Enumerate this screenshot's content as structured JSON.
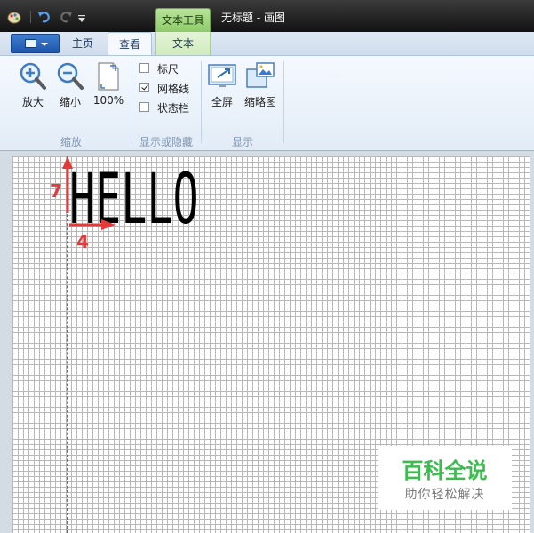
{
  "window": {
    "context_tab_header": "文本工具",
    "title": "无标题 - 画图"
  },
  "tabs": {
    "home": "主页",
    "view": "查看",
    "text": "文本"
  },
  "ribbon": {
    "zoom_group": {
      "label": "缩放",
      "zoom_in": "放大",
      "zoom_out": "缩小",
      "zoom_100": "100%"
    },
    "show_hide_group": {
      "label": "显示或隐藏",
      "items": [
        {
          "label": "标尺",
          "checked": false
        },
        {
          "label": "网格线",
          "checked": true
        },
        {
          "label": "状态栏",
          "checked": false
        }
      ]
    },
    "display_group": {
      "label": "显示",
      "fullscreen": "全屏",
      "thumbnail": "缩略图"
    }
  },
  "canvas": {
    "text": "HELLO",
    "annotations": {
      "vertical_number": "7",
      "horizontal_number": "4",
      "color": "#e53a3a"
    }
  },
  "watermark": {
    "title": "百科全说",
    "subtitle": "助你轻松解决",
    "color": "#3dbb4f"
  }
}
